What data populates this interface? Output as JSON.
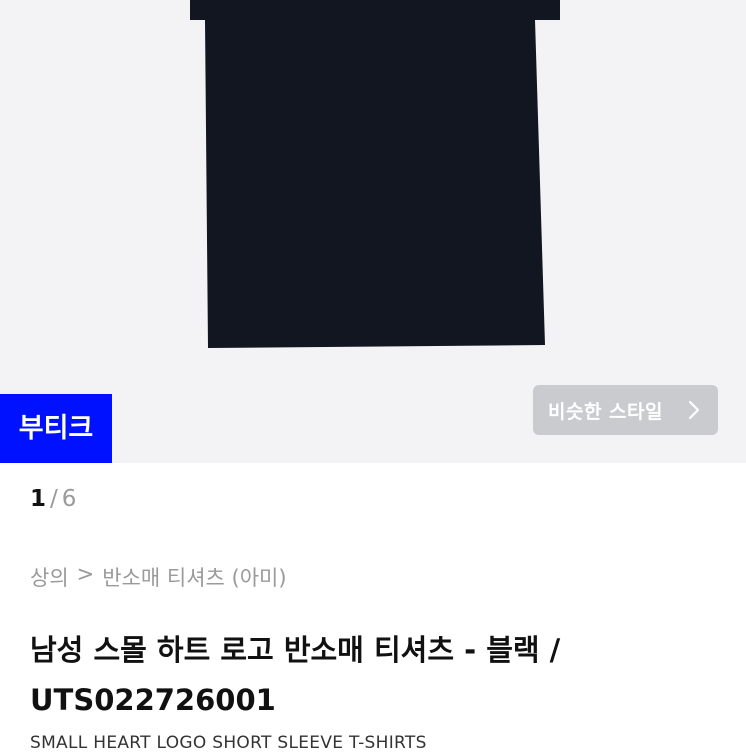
{
  "gallery": {
    "badge": "부티크",
    "similar_style_label": "비슷한 스타일",
    "similar_style_icon": "chevron-right-icon",
    "shirt_color": "#121621"
  },
  "pager": {
    "current": "1",
    "separator": "/",
    "total": "6"
  },
  "breadcrumb": {
    "category": "상의",
    "separator": ">",
    "subcategory": "반소매 티셔츠 (아미)"
  },
  "product": {
    "title": "남성 스몰 하트 로고 반소매 티셔츠 - 블랙 / UTS022726001",
    "subtitle": "SMALL HEART LOGO SHORT SLEEVE T-SHIRTS"
  }
}
